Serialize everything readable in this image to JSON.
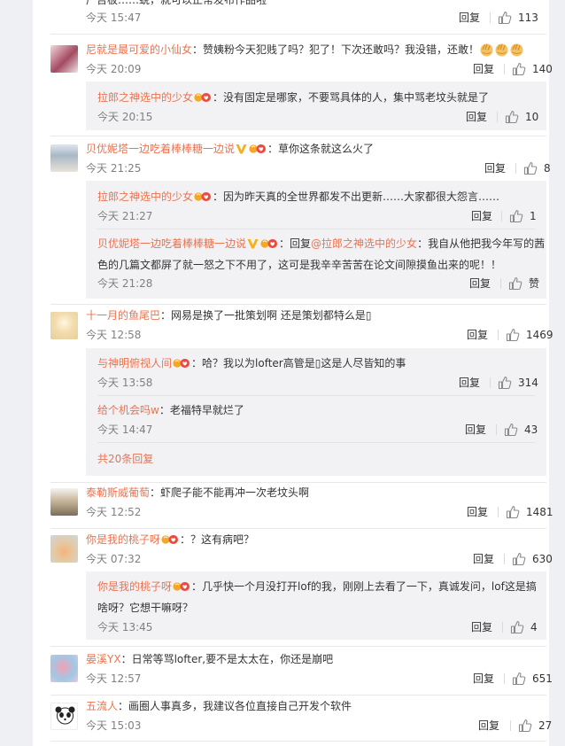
{
  "labels": {
    "reply": "回复",
    "praise": "赞",
    "colon": "："
  },
  "c0": {
    "time": "今天 15:47",
    "likes": "113",
    "partial": "广告板……蜕，就可以正常发布作品啦"
  },
  "c1": {
    "user": "尼就是最可爱的小仙女",
    "text": "赞姨粉今天犯贱了吗？犯了！下次还敢吗？我没错，还敢！",
    "time": "今天 20:09",
    "likes": "140",
    "r1": {
      "user": "拉郎之神选中的少女",
      "text": "没有固定是哪家，不要骂具体的人，集中骂老坟头就是了",
      "time": "今天 20:15",
      "likes": "10"
    }
  },
  "c2": {
    "user": "贝优妮塔一边吃着棒棒糖一边说",
    "text": "草你这条就这么火了",
    "time": "今天 21:25",
    "likes": "8",
    "r1": {
      "user": "拉郎之神选中的少女",
      "text": "因为昨天真的全世界都发不出更新……大家都很大怨言……",
      "time": "今天 21:27",
      "likes": "1"
    },
    "r2": {
      "user": "贝优妮塔一边吃着棒棒糖一边说",
      "reply_word": "回复",
      "mention": "@拉郎之神选中的少女",
      "text1": "我自从他把我今年写的茜",
      "text2": "色的几篇文都屏了就一怒之下不用了，这可是我辛辛苦苦在论文间隙摸鱼出来的呢！！",
      "time": "今天 21:28",
      "likes": "赞"
    }
  },
  "c3": {
    "user": "十一月的鱼尾巴",
    "text": "网易是换了一批策划啊 还是策划都特么是▯",
    "time": "今天 12:58",
    "likes": "1469",
    "r1": {
      "user": "与神明俯视人间",
      "text": "哈？我以为lofter高管是▯这是人尽皆知的事",
      "time": "今天 13:58",
      "likes": "314"
    },
    "r2": {
      "user": "给个机会吗w",
      "text": "老福特早就烂了",
      "time": "今天 14:47",
      "likes": "43"
    },
    "more": "共20条回复"
  },
  "c4": {
    "user": "泰勒斯威葡萄",
    "text": "虾爬子能不能再冲一次老坟头啊",
    "time": "今天 12:52",
    "likes": "1481"
  },
  "c5": {
    "user": "你是我的桃子呀",
    "text": "？这有病吧？",
    "time": "今天 07:32",
    "likes": "630",
    "r1": {
      "user": "你是我的桃子呀",
      "text1": "几乎快一个月没打开lof的我，刚刚上去看了一下，真诚发问，lof这是搞",
      "text2": "啥呀？它想干嘛呀？",
      "time": "今天 13:45",
      "likes": "4"
    }
  },
  "c6": {
    "user": "晏溪YX",
    "text": "日常等骂lofter,要不是太太在，你还是崩吧",
    "time": "今天 12:57",
    "likes": "651"
  },
  "c7": {
    "user": "五流人",
    "text": "画圈人事真多，我建议各位直接自己开发个软件",
    "time": "今天 15:03",
    "likes": "27"
  },
  "colors": {
    "username": "#eb7350",
    "time": "#808080",
    "subbox_bg": "#f2f2f5",
    "page_bg": "#f2f2f5"
  },
  "icons": [
    "thumb-up-icon",
    "fan-badge-icon",
    "vip-v-icon",
    "clap-emoji-icon"
  ]
}
